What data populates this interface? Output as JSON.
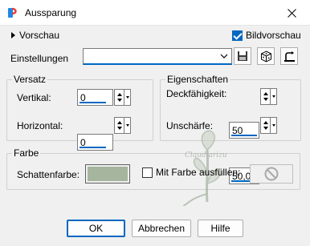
{
  "window": {
    "title": "Aussparung"
  },
  "preview": {
    "toggle_label": "Vorschau",
    "checkbox_label": "Bildvorschau",
    "checked": true
  },
  "presets": {
    "label": "Einstellungen",
    "value": ""
  },
  "offset_group": {
    "title": "Versatz",
    "vertical_label": "Vertikal:",
    "vertical_value": "0",
    "horizontal_label": "Horizontal:",
    "horizontal_value": "0"
  },
  "properties_group": {
    "title": "Eigenschaften",
    "opacity_label": "Deckfähigkeit:",
    "opacity_value": "50",
    "blur_label": "Unschärfe:",
    "blur_value": "50,00"
  },
  "color_group": {
    "title": "Farbe",
    "shadow_color_label": "Schattenfarbe:",
    "shadow_color": "#a6b59e",
    "fill_label": "Mit Farbe ausfüllen:",
    "fill_checked": false
  },
  "watermark": {
    "text": "Claudiarizu"
  },
  "buttons": {
    "ok": "OK",
    "cancel": "Abbrechen",
    "help": "Hilfe"
  },
  "colors": {
    "accent": "#0067c0",
    "dialog_bg": "#f0f0f0",
    "title_bg": "#ffffff"
  }
}
